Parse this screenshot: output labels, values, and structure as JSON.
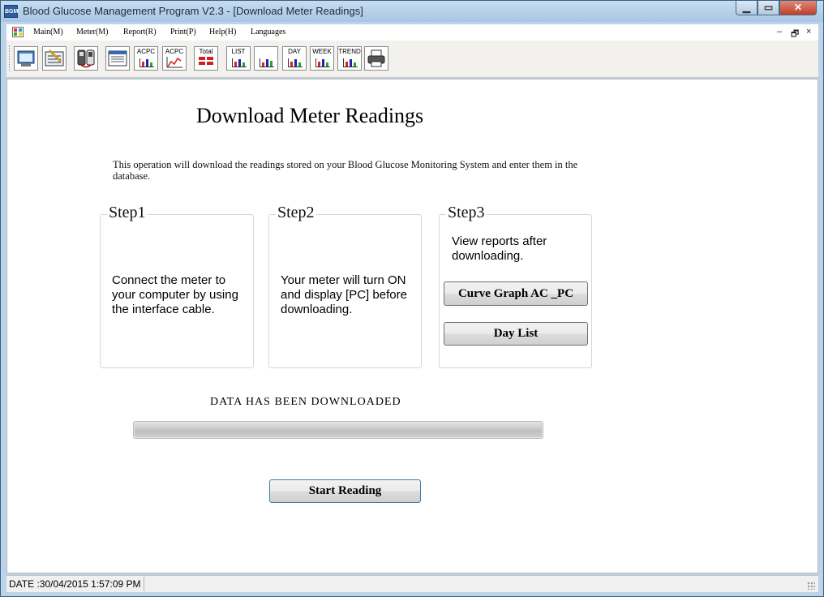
{
  "window": {
    "icon_text": "BGM",
    "title": "Blood Glucose Management Program V2.3 - [Download Meter Readings]",
    "min_glyph": "▁",
    "max_glyph": "▭",
    "close_glyph": "✕"
  },
  "menu": {
    "items": [
      "Main(M)",
      "Meter(M)",
      "Report(R)",
      "Print(P)",
      "Help(H)",
      "Languages"
    ],
    "mdi_min": "–",
    "mdi_restore": "🗗",
    "mdi_close": "×"
  },
  "toolbar": {
    "buttons": [
      {
        "icon": "window-settings-icon",
        "label": ""
      },
      {
        "icon": "edit-data-icon",
        "label": ""
      },
      {
        "icon": "meter-download-icon",
        "label": ""
      },
      {
        "icon": "logbook-icon",
        "label": ""
      },
      {
        "icon": "acpc-chart-icon",
        "label": "ACPC"
      },
      {
        "icon": "acpc-graph-icon",
        "label": "ACPC"
      },
      {
        "icon": "total-icon",
        "label": "Total"
      },
      {
        "icon": "list-icon",
        "label": "LIST"
      },
      {
        "icon": "bar-chart-icon",
        "label": ""
      },
      {
        "icon": "day-chart-icon",
        "label": "DAY"
      },
      {
        "icon": "week-chart-icon",
        "label": "WEEK"
      },
      {
        "icon": "trend-chart-icon",
        "label": "TREND"
      },
      {
        "icon": "printer-icon",
        "label": ""
      }
    ]
  },
  "page": {
    "title": "Download Meter Readings",
    "description": "This operation will download the readings stored on your Blood Glucose Monitoring System and enter them in the database.",
    "step1": {
      "legend": "Step1",
      "text": "Connect the meter to your computer by using the interface cable."
    },
    "step2": {
      "legend": "Step2",
      "text": "Your meter will turn ON and display [PC] before downloading."
    },
    "step3": {
      "legend": "Step3",
      "text": "View reports after downloading.",
      "curve_button": "Curve Graph AC _PC",
      "daylist_button": "Day List"
    },
    "status_message": "DATA HAS BEEN DOWNLOADED",
    "progress_fraction": 1.0,
    "start_button": "Start Reading"
  },
  "statusbar": {
    "date": "DATE :30/04/2015 1:57:09 PM"
  },
  "colors": {
    "title_bar": "#bcd3ea",
    "close_button": "#c0402a",
    "start_button_border": "#3c7fb1"
  }
}
